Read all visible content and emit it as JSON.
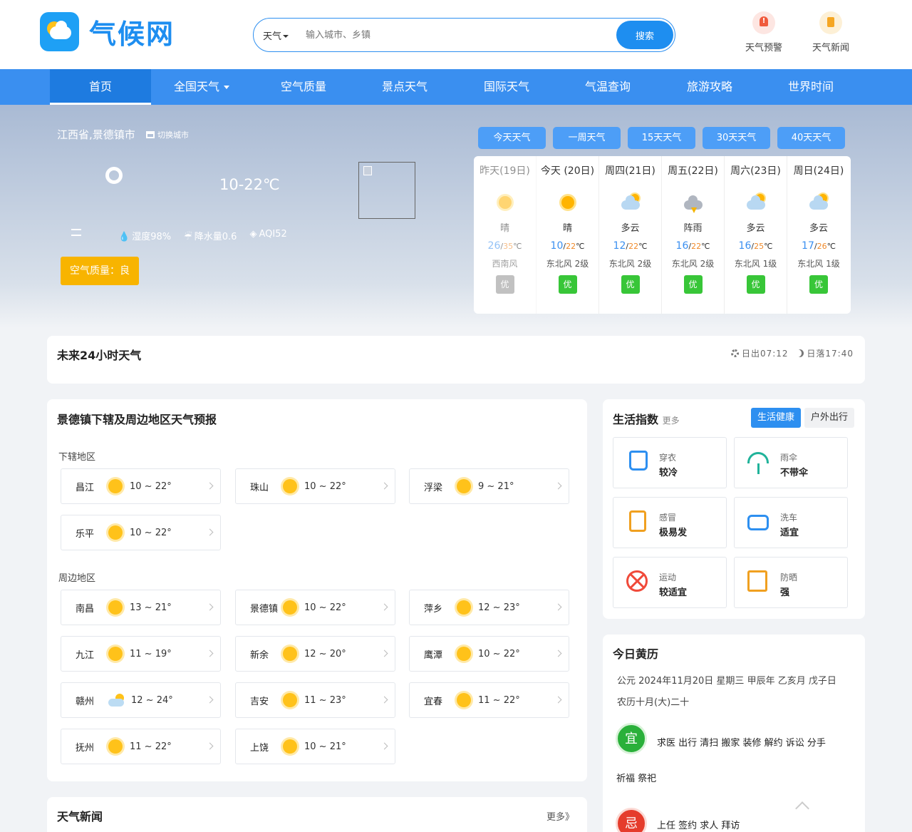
{
  "brand": {
    "name": "气候网"
  },
  "search": {
    "type_label": "天气",
    "placeholder": "输入城市、乡镇",
    "button": "搜索"
  },
  "header_links": [
    {
      "label": "天气预警",
      "icon": "alert-icon"
    },
    {
      "label": "天气新闻",
      "icon": "news-icon"
    }
  ],
  "nav": [
    "首页",
    "全国天气",
    "空气质量",
    "景点天气",
    "国际天气",
    "气温查询",
    "旅游攻略",
    "世界时间"
  ],
  "current": {
    "location": "江西省,景德镇市",
    "switch_city": "切换城市",
    "temp_range": "10-22℃",
    "humidity": "湿度98%",
    "precip": "降水量0.6",
    "aqi": "AQI52",
    "air_quality_button": "空气质量：良"
  },
  "range_tabs": [
    "今天天气",
    "一周天气",
    "15天天气",
    "30天天气",
    "40天天气"
  ],
  "forecast": [
    {
      "day": "昨天(19日)",
      "icon": "sunny",
      "cond": "晴",
      "lo": "26",
      "hi": "35",
      "wind": "西南风",
      "aqi": "优",
      "past": true
    },
    {
      "day": "今天 (20日)",
      "icon": "sunny",
      "cond": "晴",
      "lo": "10",
      "hi": "22",
      "wind": "东北风 2级",
      "aqi": "优"
    },
    {
      "day": "周四(21日)",
      "icon": "cloudy",
      "cond": "多云",
      "lo": "12",
      "hi": "22",
      "wind": "东北风 2级",
      "aqi": "优"
    },
    {
      "day": "周五(22日)",
      "icon": "thunder",
      "cond": "阵雨",
      "lo": "16",
      "hi": "22",
      "wind": "东北风 2级",
      "aqi": "优"
    },
    {
      "day": "周六(23日)",
      "icon": "cloudy",
      "cond": "多云",
      "lo": "16",
      "hi": "25",
      "wind": "东北风 1级",
      "aqi": "优"
    },
    {
      "day": "周日(24日)",
      "icon": "cloudy",
      "cond": "多云",
      "lo": "17",
      "hi": "26",
      "wind": "东北风 1级",
      "aqi": "优"
    }
  ],
  "temp_unit": "℃",
  "hourly": {
    "title": "未来24小时天气",
    "sunrise": "日出07:12",
    "sunset": "日落17:40"
  },
  "regional": {
    "title": "景德镇下辖及周边地区天气预报",
    "sub_label": "下辖地区",
    "sub": [
      {
        "name": "昌江",
        "temp": "10 ~ 22°",
        "icon": "sunny"
      },
      {
        "name": "珠山",
        "temp": "10 ~ 22°",
        "icon": "sunny"
      },
      {
        "name": "浮梁",
        "temp": "9 ~ 21°",
        "icon": "sunny"
      },
      {
        "name": "乐平",
        "temp": "10 ~ 22°",
        "icon": "sunny"
      }
    ],
    "near_label": "周边地区",
    "near": [
      {
        "name": "南昌",
        "temp": "13 ~ 21°",
        "icon": "sunny"
      },
      {
        "name": "景德镇",
        "temp": "10 ~ 22°",
        "icon": "sunny"
      },
      {
        "name": "萍乡",
        "temp": "12 ~ 23°",
        "icon": "sunny"
      },
      {
        "name": "九江",
        "temp": "11 ~ 19°",
        "icon": "sunny"
      },
      {
        "name": "新余",
        "temp": "12 ~ 20°",
        "icon": "sunny"
      },
      {
        "name": "鹰潭",
        "temp": "10 ~ 22°",
        "icon": "sunny"
      },
      {
        "name": "赣州",
        "temp": "12 ~ 24°",
        "icon": "cloudy"
      },
      {
        "name": "吉安",
        "temp": "11 ~ 23°",
        "icon": "sunny"
      },
      {
        "name": "宜春",
        "temp": "11 ~ 22°",
        "icon": "sunny"
      },
      {
        "name": "抚州",
        "temp": "11 ~ 22°",
        "icon": "sunny"
      },
      {
        "name": "上饶",
        "temp": "10 ~ 21°",
        "icon": "sunny"
      }
    ]
  },
  "life": {
    "title": "生活指数",
    "more": "更多",
    "tabs": [
      "生活健康",
      "户外出行"
    ],
    "cards": [
      {
        "name": "穿衣",
        "value": "较冷",
        "icon": "shirt-icon"
      },
      {
        "name": "雨伞",
        "value": "不带伞",
        "icon": "umbrella-icon"
      },
      {
        "name": "感冒",
        "value": "极易发",
        "icon": "cold-medicine-icon"
      },
      {
        "name": "洗车",
        "value": "适宜",
        "icon": "car-icon"
      },
      {
        "name": "运动",
        "value": "较适宜",
        "icon": "sport-icon"
      },
      {
        "name": "防晒",
        "value": "强",
        "icon": "sunscreen-icon"
      }
    ]
  },
  "almanac": {
    "title": "今日黄历",
    "solar": "公元 2024年11月20日 星期三 甲辰年 乙亥月 戊子日",
    "lunar": "农历十月(大)二十",
    "yi_label": "宜",
    "yi": "求医 出行 清扫 搬家 装修 解约 诉讼 分手",
    "yi_more": "祈福 祭祀",
    "ji_label": "忌",
    "ji": "上任 签约 求人 拜访"
  },
  "news": {
    "title": "天气新闻",
    "more": "更多》"
  }
}
